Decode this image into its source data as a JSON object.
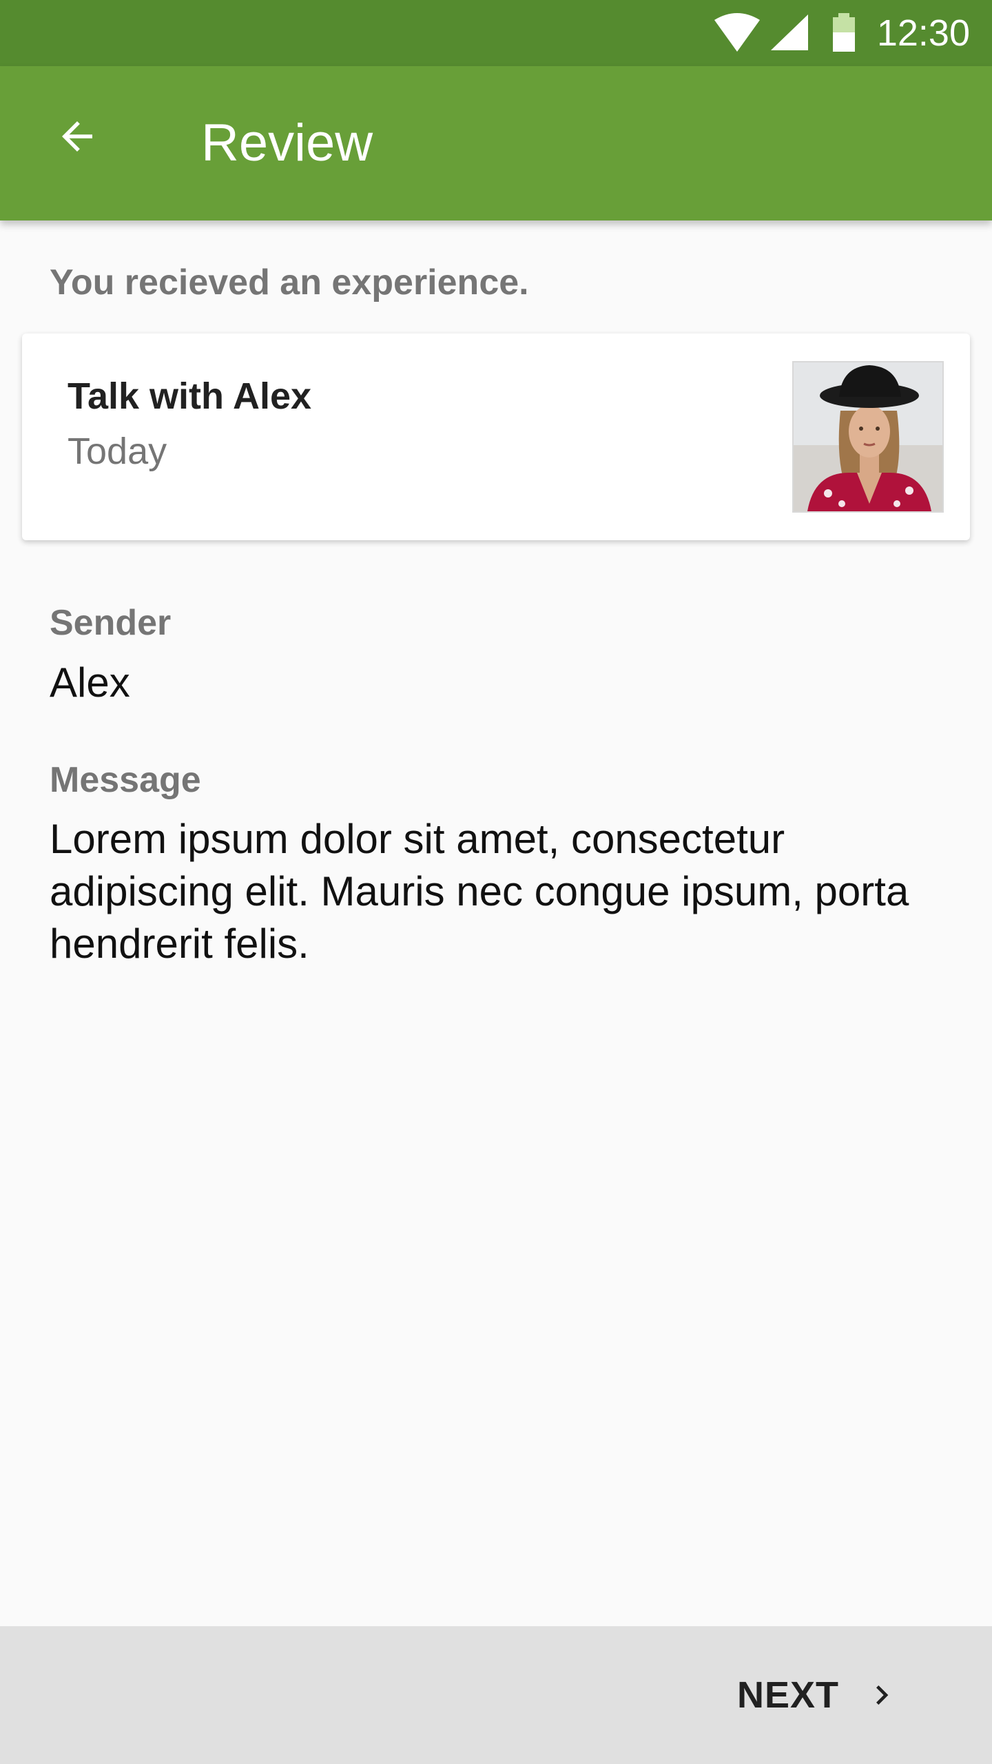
{
  "status_bar": {
    "time": "12:30",
    "icons": [
      "wifi-icon",
      "cell-signal-icon",
      "battery-icon"
    ],
    "background": "#558b2f"
  },
  "app_bar": {
    "title": "Review",
    "back_icon": "arrow-back-icon",
    "background": "#689f38"
  },
  "intro": {
    "text": "You recieved an experience."
  },
  "experience_card": {
    "title": "Talk with Alex",
    "date": "Today",
    "image": "avatar-photo"
  },
  "fields": {
    "sender_label": "Sender",
    "sender_value": "Alex",
    "message_label": "Message",
    "message_value": "Lorem ipsum dolor sit amet, consectetur adipiscing elit. Mauris nec congue ipsum, porta hendrerit felis."
  },
  "bottom_bar": {
    "next_label": "NEXT",
    "next_icon": "chevron-right-icon"
  }
}
